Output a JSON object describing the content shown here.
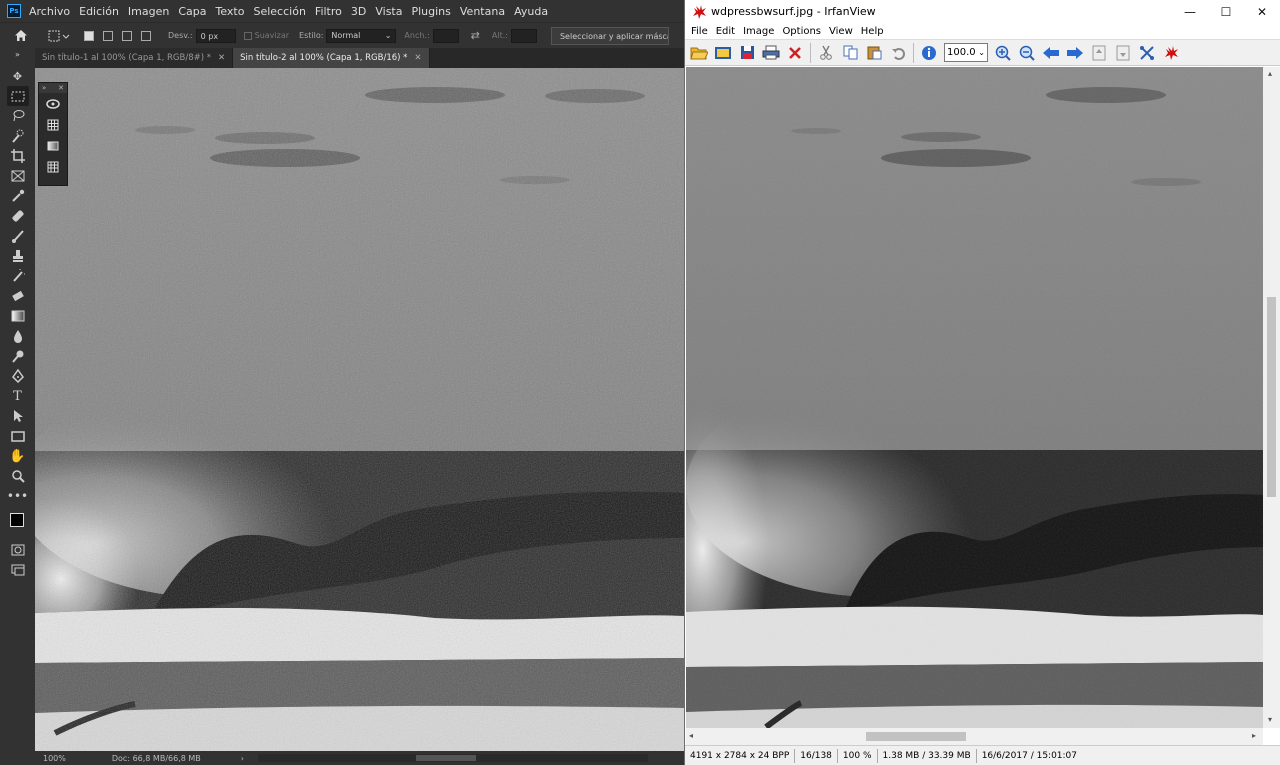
{
  "photoshop": {
    "logo": "Ps",
    "menu": [
      "Archivo",
      "Edición",
      "Imagen",
      "Capa",
      "Texto",
      "Selección",
      "Filtro",
      "3D",
      "Vista",
      "Plugins",
      "Ventana",
      "Ayuda"
    ],
    "options": {
      "desv_label": "Desv.:",
      "desv_value": "0 px",
      "suavizar_label": "Suavizar",
      "estilo_label": "Estilo:",
      "estilo_value": "Normal",
      "anch_label": "Anch.:",
      "alt_label": "Alt.:",
      "mask_button": "Seleccionar y aplicar máscara..."
    },
    "tabs": [
      {
        "label": "Sin título-1 al 100% (Capa 1, RGB/8#) *",
        "active": false
      },
      {
        "label": "Sin título-2 al 100% (Capa 1, RGB/16) *",
        "active": true
      }
    ],
    "float_panel": {
      "collapse": "»",
      "close": "✕"
    },
    "status": {
      "zoom": "100%",
      "doc": "Doc: 66,8 MB/66,8 MB",
      "arrow": "›"
    }
  },
  "irfanview": {
    "title": "wdpressbwsurf.jpg - IrfanView",
    "window_buttons": {
      "minimize": "—",
      "maximize": "☐",
      "close": "✕"
    },
    "menu": [
      "File",
      "Edit",
      "Image",
      "Options",
      "View",
      "Help"
    ],
    "zoom_value": "100.0",
    "status": {
      "dimensions": "4191 x 2784 x 24 BPP",
      "index": "16/138",
      "zoom": "100 %",
      "size": "1.38 MB / 33.39 MB",
      "datetime": "16/6/2017 / 15:01:07"
    }
  },
  "colors": {
    "ps_bg": "#323232",
    "ps_canvas_sky": "#8a8a8a",
    "iv_accent": "#0078d7"
  }
}
